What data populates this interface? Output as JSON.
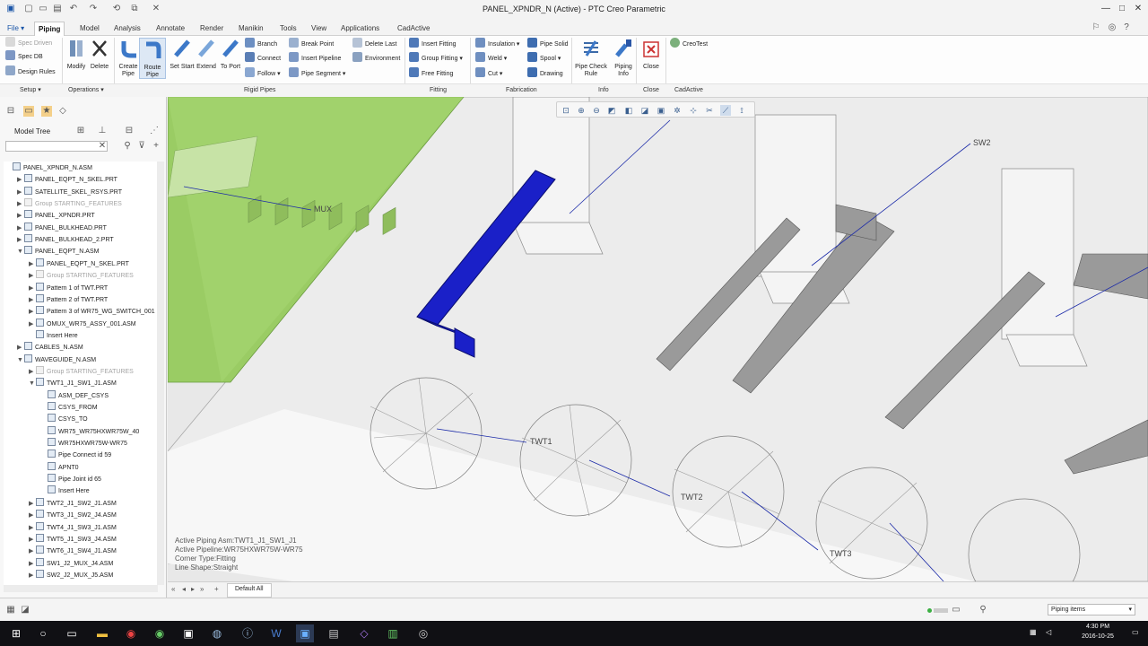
{
  "window": {
    "title": "PANEL_XPNDR_N (Active) - PTC Creo Parametric",
    "quick_access_icons": [
      "app-icon",
      "new-icon",
      "open-icon",
      "save-icon",
      "undo-icon",
      "redo-icon",
      "regenerate-icon",
      "windows-icon",
      "close-window-icon"
    ],
    "controls": [
      "—",
      "□",
      "✕"
    ]
  },
  "tabs": [
    {
      "label": "File",
      "state": "menu"
    },
    {
      "label": "Piping",
      "state": "active"
    },
    {
      "label": "Model",
      "state": "normal"
    },
    {
      "label": "Analysis",
      "state": "normal"
    },
    {
      "label": "Annotate",
      "state": "normal"
    },
    {
      "label": "Render",
      "state": "normal"
    },
    {
      "label": "Manikin",
      "state": "normal"
    },
    {
      "label": "Tools",
      "state": "normal"
    },
    {
      "label": "View",
      "state": "normal"
    },
    {
      "label": "Applications",
      "state": "normal"
    },
    {
      "label": "CadActive",
      "state": "normal"
    }
  ],
  "ribbon": {
    "setup_items": [
      "Spec Driven",
      "Spec DB",
      "Design Rules"
    ],
    "operations": [
      "Modify",
      "Delete"
    ],
    "create_pipe": "Create Pipe",
    "route_pipe": "Route Pipe",
    "set_start": "Set Start",
    "extend": "Extend",
    "to_port": "To Port",
    "rigid_col1": [
      "Branch",
      "Connect",
      "Follow"
    ],
    "rigid_col2": [
      "Break Point",
      "Insert Pipeline",
      "Pipe Segment"
    ],
    "rigid_col3": [
      "Delete Last",
      "Environment"
    ],
    "fitting_col": [
      "Insert Fitting",
      "Group Fitting",
      "Free Fitting"
    ],
    "fab_col1": [
      "Insulation",
      "Weld",
      "Cut"
    ],
    "fab_col2": [
      "Pipe Solid",
      "Spool",
      "Drawing"
    ],
    "pipe_check_rule": "Pipe Check Rule",
    "piping_info": "Piping Info",
    "close": "Close",
    "creotest": "CreoTest",
    "groups": [
      "Setup",
      "Operations",
      "Rigid Pipes",
      "Fitting",
      "Fabrication",
      "Info",
      "Close",
      "CadActive"
    ]
  },
  "model_tree": {
    "label": "Model Tree",
    "search_placeholder": "",
    "rows": [
      {
        "label": "PANEL_XPNDR_N.ASM",
        "level": 0,
        "twisty": "",
        "dim": false
      },
      {
        "label": "PANEL_EQPT_N_SKEL.PRT",
        "level": 1,
        "twisty": "▶",
        "dim": false
      },
      {
        "label": "SATELLITE_SKEL_RSYS.PRT",
        "level": 1,
        "twisty": "▶",
        "dim": false
      },
      {
        "label": "Group STARTING_FEATURES",
        "level": 1,
        "twisty": "▶",
        "dim": true
      },
      {
        "label": "PANEL_XPNDR.PRT",
        "level": 1,
        "twisty": "▶",
        "dim": false
      },
      {
        "label": "PANEL_BULKHEAD.PRT",
        "level": 1,
        "twisty": "▶",
        "dim": false
      },
      {
        "label": "PANEL_BULKHEAD_2.PRT",
        "level": 1,
        "twisty": "▶",
        "dim": false
      },
      {
        "label": "PANEL_EQPT_N.ASM",
        "level": 1,
        "twisty": "▼",
        "dim": false
      },
      {
        "label": "PANEL_EQPT_N_SKEL.PRT",
        "level": 2,
        "twisty": "▶",
        "dim": false
      },
      {
        "label": "Group STARTING_FEATURES",
        "level": 2,
        "twisty": "▶",
        "dim": true
      },
      {
        "label": "Pattern 1 of TWT.PRT",
        "level": 2,
        "twisty": "▶",
        "dim": false
      },
      {
        "label": "Pattern 2 of TWT.PRT",
        "level": 2,
        "twisty": "▶",
        "dim": false
      },
      {
        "label": "Pattern 3 of WR75_WG_SWITCH_001",
        "level": 2,
        "twisty": "▶",
        "dim": false
      },
      {
        "label": "OMUX_WR75_ASSY_001.ASM",
        "level": 2,
        "twisty": "▶",
        "dim": false
      },
      {
        "label": "Insert Here",
        "level": 2,
        "twisty": "",
        "dim": false
      },
      {
        "label": "CABLES_N.ASM",
        "level": 1,
        "twisty": "▶",
        "dim": false
      },
      {
        "label": "WAVEGUIDE_N.ASM",
        "level": 1,
        "twisty": "▼",
        "dim": false
      },
      {
        "label": "Group STARTING_FEATURES",
        "level": 2,
        "twisty": "▶",
        "dim": true
      },
      {
        "label": "TWT1_J1_SW1_J1.ASM",
        "level": 2,
        "twisty": "▼",
        "dim": false
      },
      {
        "label": "ASM_DEF_CSYS",
        "level": 3,
        "twisty": "",
        "dim": false
      },
      {
        "label": "CSYS_FROM",
        "level": 3,
        "twisty": "",
        "dim": false
      },
      {
        "label": "CSYS_TO",
        "level": 3,
        "twisty": "",
        "dim": false
      },
      {
        "label": "WR75_WR75HXWR75W_40",
        "level": 3,
        "twisty": "",
        "dim": false
      },
      {
        "label": "WR75HXWR75W-WR75",
        "level": 3,
        "twisty": "",
        "dim": false
      },
      {
        "label": "Pipe Connect id 59",
        "level": 3,
        "twisty": "",
        "dim": false
      },
      {
        "label": "APNT0",
        "level": 3,
        "twisty": "",
        "dim": false
      },
      {
        "label": "Pipe Joint id 65",
        "level": 3,
        "twisty": "",
        "dim": false
      },
      {
        "label": "Insert Here",
        "level": 3,
        "twisty": "",
        "dim": false
      },
      {
        "label": "TWT2_J1_SW2_J1.ASM",
        "level": 2,
        "twisty": "▶",
        "dim": false
      },
      {
        "label": "TWT3_J1_SW2_J4.ASM",
        "level": 2,
        "twisty": "▶",
        "dim": false
      },
      {
        "label": "TWT4_J1_SW3_J1.ASM",
        "level": 2,
        "twisty": "▶",
        "dim": false
      },
      {
        "label": "TWT5_J1_SW3_J4.ASM",
        "level": 2,
        "twisty": "▶",
        "dim": false
      },
      {
        "label": "TWT6_J1_SW4_J1.ASM",
        "level": 2,
        "twisty": "▶",
        "dim": false
      },
      {
        "label": "SW1_J2_MUX_J4.ASM",
        "level": 2,
        "twisty": "▶",
        "dim": false
      },
      {
        "label": "SW2_J2_MUX_J5.ASM",
        "level": 2,
        "twisty": "▶",
        "dim": false
      }
    ]
  },
  "viewport": {
    "labels": [
      "MUX",
      "SW2",
      "TWT1",
      "TWT2",
      "TWT3"
    ],
    "status_lines": [
      "Active Piping Asm:TWT1_J1_SW1_J1",
      "Active Pipeline:WR75HXWR75W-WR75",
      "Corner Type:Fitting",
      "Line Shape:Straight"
    ]
  },
  "bottom": {
    "tab_label": "Default All",
    "filter_value": "Piping items"
  },
  "taskbar": {
    "time": "4:30 PM",
    "date": "2016-10-25"
  },
  "colors": {
    "accent": "#1b56a8",
    "route_pipe_blue": "#1a20c8",
    "panel_green": "#9acc64"
  }
}
